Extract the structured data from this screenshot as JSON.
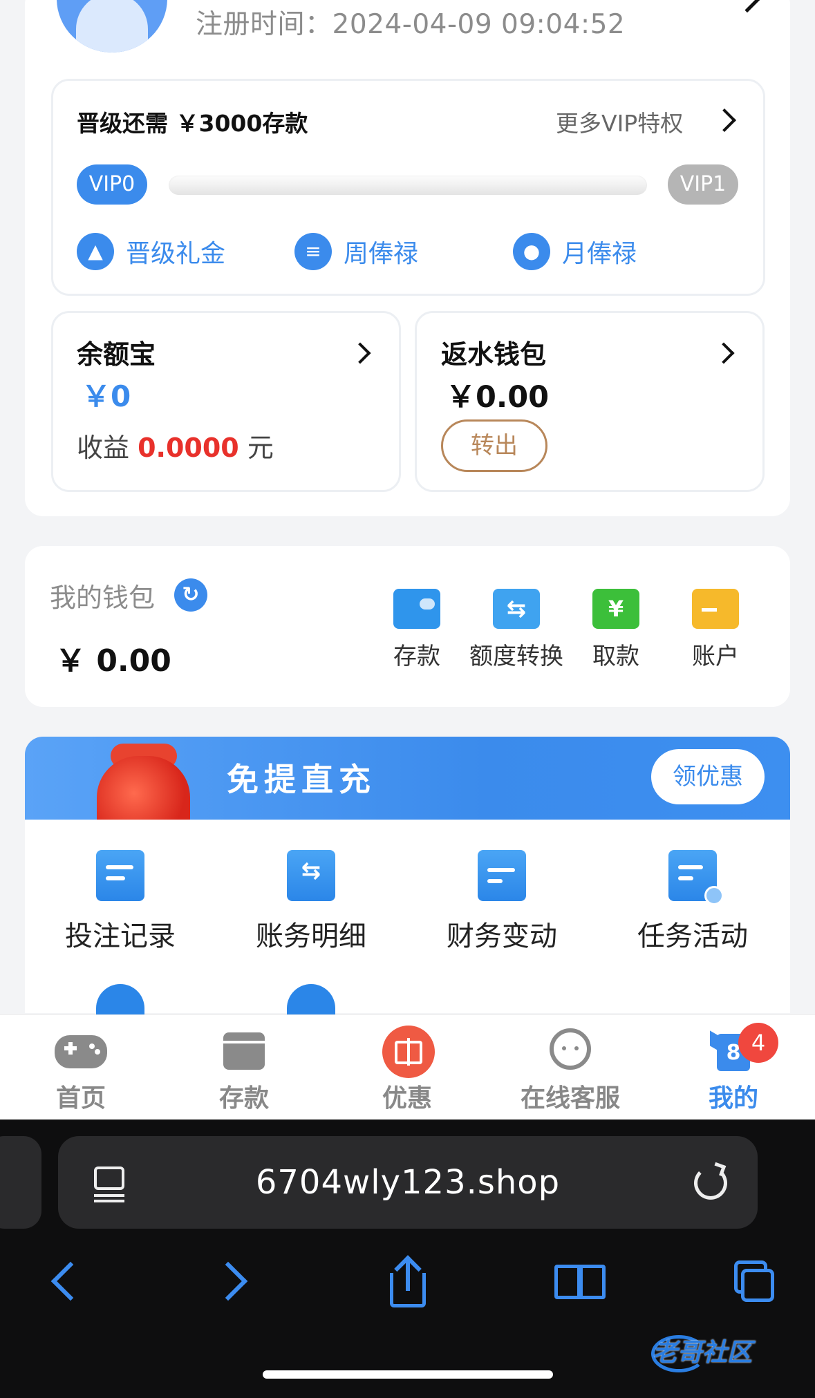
{
  "profile": {
    "register_time": "注册时间：2024-04-09 09:04:52"
  },
  "vip": {
    "need_text": "晋级还需 ￥3000存款",
    "more_text": "更多VIP特权",
    "current_level": "VIP0",
    "next_level": "VIP1",
    "progress": 0,
    "perks": [
      {
        "label": "晋级礼金",
        "icon": "upgrade-arrow-icon"
      },
      {
        "label": "周俸禄",
        "icon": "clipboard-icon"
      },
      {
        "label": "月俸禄",
        "icon": "money-bag-icon"
      }
    ]
  },
  "yuebao": {
    "title": "余额宝",
    "amount": "￥0",
    "income_prefix": "收益",
    "income_value": "0.0000",
    "income_unit": "元"
  },
  "rebate_wallet": {
    "title": "返水钱包",
    "amount": "￥0.00",
    "transfer_label": "转出"
  },
  "wallet": {
    "title": "我的钱包",
    "amount": "￥ 0.00",
    "actions": [
      {
        "label": "存款",
        "icon": "wallet-icon",
        "color": "#2f95ec"
      },
      {
        "label": "额度转换",
        "icon": "transfer-icon",
        "color": "#3fa3f0"
      },
      {
        "label": "取款",
        "icon": "withdraw-icon",
        "color": "#3cbf3a"
      },
      {
        "label": "账户",
        "icon": "card-icon",
        "color": "#f6b92b"
      }
    ]
  },
  "banner": {
    "title": "免提直充",
    "button": "领优惠"
  },
  "menu": {
    "items": [
      {
        "label": "投注记录",
        "icon": "bet-record-icon"
      },
      {
        "label": "账务明细",
        "icon": "account-detail-icon"
      },
      {
        "label": "财务变动",
        "icon": "finance-change-icon"
      },
      {
        "label": "任务活动",
        "icon": "task-icon"
      }
    ]
  },
  "tabbar": {
    "tabs": [
      {
        "label": "首页",
        "icon": "gamepad-icon"
      },
      {
        "label": "存款",
        "icon": "wallet-icon"
      },
      {
        "label": "优惠",
        "icon": "gift-icon"
      },
      {
        "label": "在线客服",
        "icon": "headset-icon"
      },
      {
        "label": "我的",
        "icon": "jersey-icon"
      }
    ],
    "active_index": 4,
    "badge": "4",
    "jersey_number": "8"
  },
  "browser": {
    "url": "6704wly123.shop"
  },
  "watermark": "老哥社区",
  "colors": {
    "accent": "#3b8bec",
    "income_red": "#e8312b",
    "transfer_brown": "#b8875a",
    "badge_red": "#f0473e"
  }
}
